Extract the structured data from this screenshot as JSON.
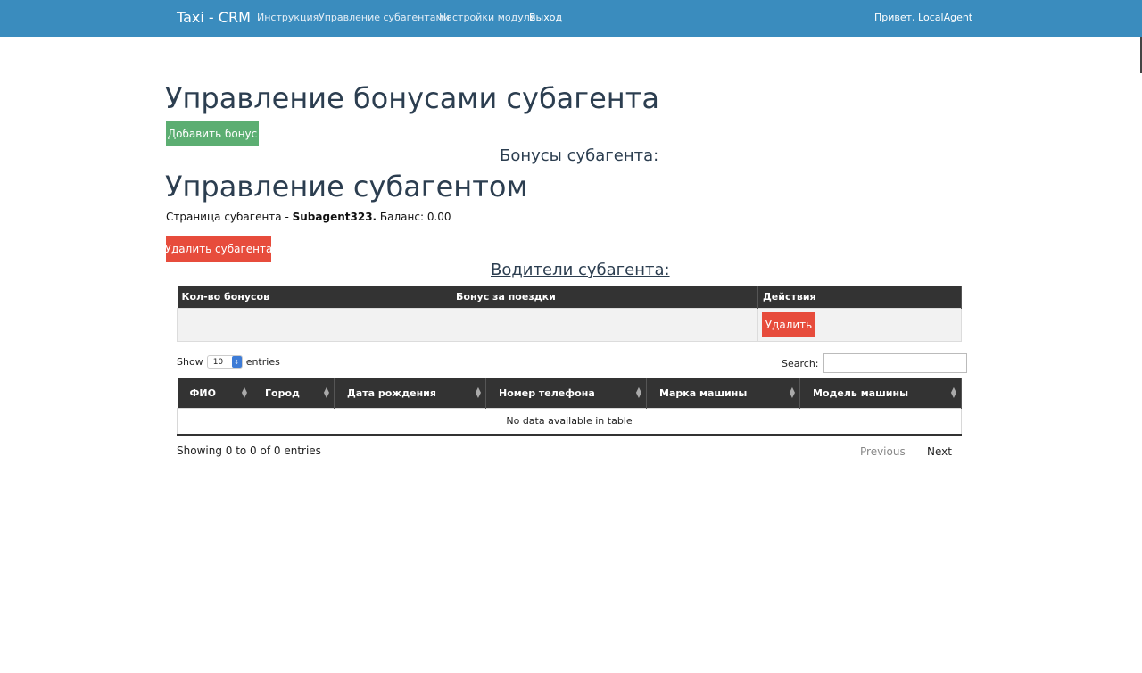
{
  "navbar": {
    "brand": "Taxi - CRM",
    "links": [
      "Инструкция",
      "Управление субагентами",
      "Настройки модуля",
      "Выход"
    ],
    "greeting": "Привет, LocalAgent"
  },
  "bonus_section": {
    "title": "Управление бонусами субагента",
    "add_button": "Добавить бонус",
    "heading": "Бонусы субагента:"
  },
  "subagent_section": {
    "title": "Управление субагентом",
    "info_prefix": "Страница субагента - ",
    "name": "Subagent323.",
    "balance": " Баланс: 0.00",
    "delete_button": "Удалить субагента",
    "drivers_heading": "Водители субагента:"
  },
  "bonus_table": {
    "columns": [
      "Кол-во бонусов",
      "Бонус за поездки",
      "Действия"
    ],
    "row_delete_button": "Удалить"
  },
  "drivers_table": {
    "length_label_before": "Show",
    "length_value": "10",
    "length_label_after": "entries",
    "search_label": "Search:",
    "columns": [
      "ФИО",
      "Город",
      "Дата рождения",
      "Номер телефона",
      "Марка машины",
      "Модель машины"
    ],
    "empty_message": "No data available in table",
    "info": "Showing 0 to 0 of 0 entries",
    "prev": "Previous",
    "next": "Next"
  }
}
